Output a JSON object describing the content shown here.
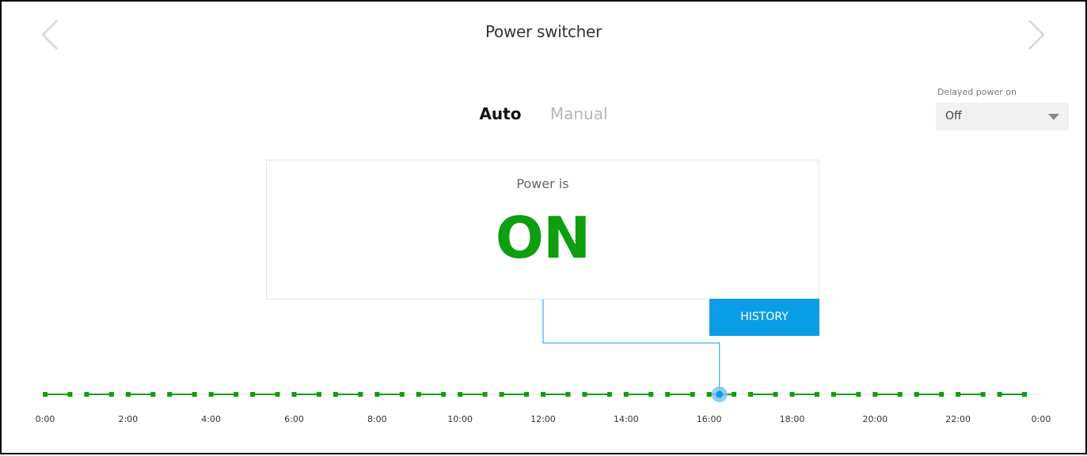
{
  "page": {
    "title": "Power switcher"
  },
  "nav": {
    "prev_icon": "chevron-left-icon",
    "next_icon": "chevron-right-icon"
  },
  "mode": {
    "tabs": [
      {
        "label": "Auto",
        "active": true
      },
      {
        "label": "Manual",
        "active": false
      }
    ]
  },
  "delayed_power_on": {
    "label": "Delayed power on",
    "value": "Off"
  },
  "status": {
    "label": "Power is",
    "value": "ON",
    "color": "#0f9e0f"
  },
  "history_button": {
    "label": "HISTORY",
    "color": "#0a9ee6"
  },
  "timeline": {
    "tick_labels": [
      "0:00",
      "2:00",
      "4:00",
      "6:00",
      "8:00",
      "10:00",
      "12:00",
      "14:00",
      "16:00",
      "18:00",
      "20:00",
      "22:00",
      "0:00"
    ],
    "hours_start": 0,
    "hours_end": 24,
    "current_time_hours": 16.25,
    "segment_color": "#0f9e0f",
    "marker_color": "#0a9ee6",
    "segments": [
      [
        0.0,
        0.6
      ],
      [
        1.0,
        1.6
      ],
      [
        2.0,
        2.6
      ],
      [
        3.0,
        3.6
      ],
      [
        4.0,
        4.6
      ],
      [
        5.0,
        5.6
      ],
      [
        6.0,
        6.6
      ],
      [
        7.0,
        7.6
      ],
      [
        8.0,
        8.6
      ],
      [
        9.0,
        9.6
      ],
      [
        10.0,
        10.6
      ],
      [
        11.0,
        11.6
      ],
      [
        12.0,
        12.6
      ],
      [
        13.0,
        13.6
      ],
      [
        14.0,
        14.6
      ],
      [
        15.0,
        15.6
      ],
      [
        16.0,
        16.6
      ],
      [
        17.0,
        17.6
      ],
      [
        18.0,
        18.6
      ],
      [
        19.0,
        19.6
      ],
      [
        20.0,
        20.6
      ],
      [
        21.0,
        21.6
      ],
      [
        22.0,
        22.6
      ],
      [
        23.0,
        23.6
      ]
    ]
  }
}
